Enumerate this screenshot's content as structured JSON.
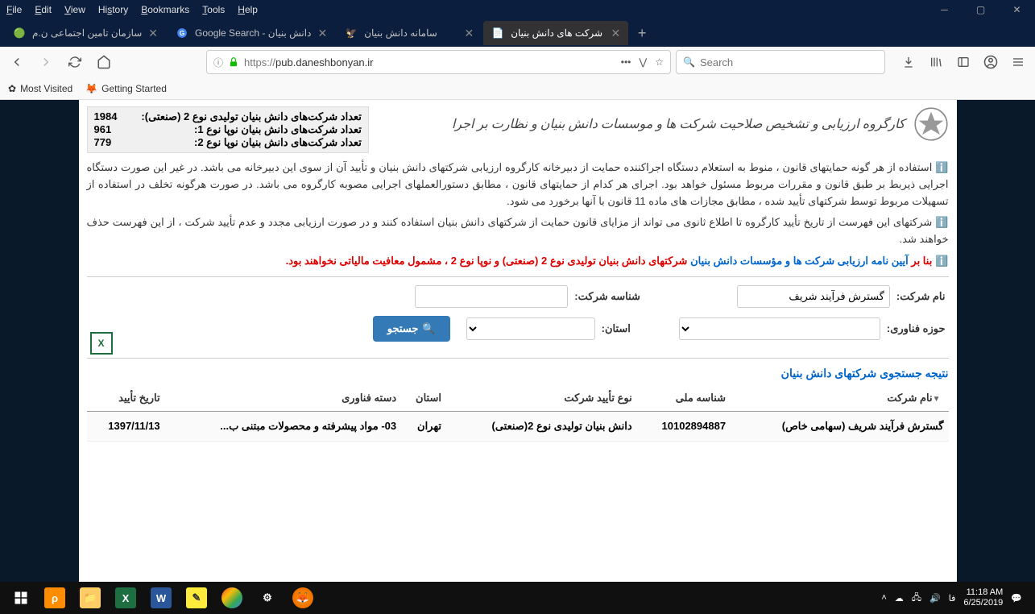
{
  "menu": {
    "file": "File",
    "edit": "Edit",
    "view": "View",
    "history": "History",
    "bookmarks": "Bookmarks",
    "tools": "Tools",
    "help": "Help"
  },
  "tabs": [
    {
      "title": "سازمان تامین اجتماعی ن.م",
      "active": false
    },
    {
      "title": "Google Search - دانش بنیان",
      "active": false
    },
    {
      "title": "سامانه دانش بنیان",
      "active": false
    },
    {
      "title": "شرکت های دانش بنیان",
      "active": true
    }
  ],
  "url": {
    "protocol": "https://",
    "host": "pub.daneshbonyan.ir",
    "path": ""
  },
  "search_placeholder": "Search",
  "bookmarks": {
    "most_visited": "Most Visited",
    "getting_started": "Getting Started"
  },
  "header": {
    "org_title": "کارگروه ارزیابی و تشخیص صلاحیت شرکت ها و موسسات دانش بنیان و نظارت بر اجرا"
  },
  "stats": [
    {
      "label": "تعداد شرکت‌های دانش بنیان تولیدی نوع 2 (صنعتی):",
      "value": "1984"
    },
    {
      "label": "تعداد شرکت‌های دانش بنیان نوپا نوع 1:",
      "value": "961"
    },
    {
      "label": "تعداد شرکت‌های دانش بنیان نوپا نوع 2:",
      "value": "779"
    }
  ],
  "info1": "استفاده از هر گونه حمایتهای قانون ، منوط به استعلام دستگاه اجراکننده حمایت از دبیرخانه کارگروه ارزیابی شرکتهای دانش بنیان و تأیید آن از سوی این دبیرخانه می باشد. در غیر این صورت دستگاه اجرایی ذیربط بر طبق قانون و مقررات مربوط مسئول خواهد بود. اجرای هر کدام از حمایتهای قانون ، مطابق دستورالعملهای اجرایی مصوبه کارگروه می باشد. در صورت هرگونه تخلف در استفاده از تسهیلات مربوط توسط شرکتهای تأیید شده ، مطابق مجازات های ماده 11 قانون با آنها برخورد می شود.",
  "info2": "شرکتهای این فهرست از تاریخ تأیید کارگروه تا اطلاع ثانوی می تواند از مزایای قانون حمایت از شرکتهای دانش بنیان استفاده کنند و در صورت ارزیابی مجدد و عدم تأیید شرکت ، از این فهرست حذف خواهند شد.",
  "info3_pre": "بنا بر",
  "info3_blue": "آیین نامه ارزیابی شرکت ها و مؤسسات دانش بنیان",
  "info3_red": "شرکتهای دانش بنیان تولیدی نوع 2 (صنعتی) و نوپا نوع 2 ، مشمول معافیت مالیاتی نخواهند بود.",
  "form": {
    "company_name_label": "نام شرکت:",
    "company_name_value": "گسترش فرآیند شریف",
    "company_id_label": "شناسه شرکت:",
    "company_id_value": "",
    "tech_area_label": "حوزه فناوری:",
    "province_label": "استان:",
    "search_btn": "جستجو"
  },
  "results_title": "نتیجه جستجوی شرکتهای دانش بنیان",
  "columns": {
    "name": "نام شرکت",
    "national_id": "شناسه ملی",
    "approval_type": "نوع تأیید شرکت",
    "province": "استان",
    "tech_category": "دسته فناوری",
    "approval_date": "تاریخ تأیید"
  },
  "rows": [
    {
      "name": "گسترش فرآیند شریف (سهامی خاص)",
      "national_id": "10102894887",
      "approval_type": "دانش بنیان تولیدی نوع 2(صنعتی)",
      "province": "تهران",
      "tech_category": "03- مواد پیشرفته و محصولات مبتنی ب...",
      "approval_date": "1397/11/13"
    }
  ],
  "taskbar": {
    "lang": "فا",
    "time": "11:18 AM",
    "date": "6/25/2019"
  }
}
